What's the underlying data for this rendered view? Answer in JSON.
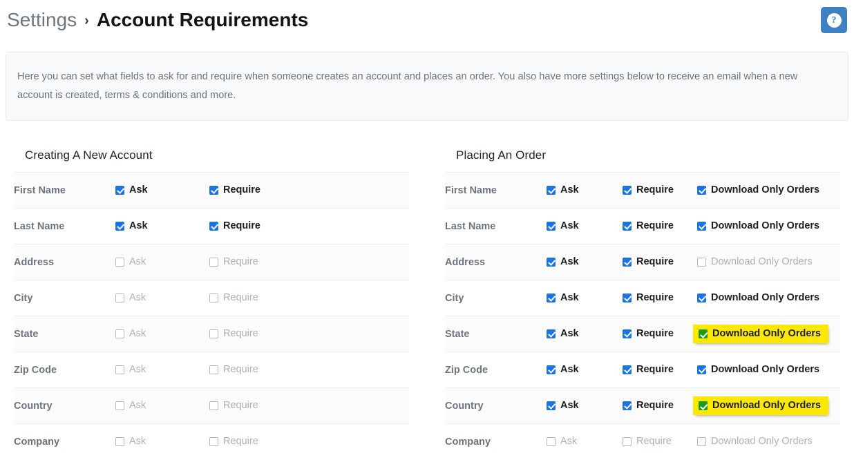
{
  "header": {
    "breadcrumb_parent": "Settings",
    "breadcrumb_separator": "›",
    "breadcrumb_current": "Account Requirements",
    "help_button_glyph": "?",
    "help_button_title": "Help"
  },
  "info_banner": {
    "text": "Here you can set what fields to ask for and require when someone creates an account and places an order. You also have more settings below to receive an email when a new account is created, terms & conditions and more."
  },
  "columns": {
    "left": {
      "title": "Creating A New Account",
      "option_labels": {
        "ask": "Ask",
        "require": "Require"
      },
      "rows": [
        {
          "field": "First Name",
          "ask": true,
          "require": true
        },
        {
          "field": "Last Name",
          "ask": true,
          "require": true
        },
        {
          "field": "Address",
          "ask": false,
          "require": false
        },
        {
          "field": "City",
          "ask": false,
          "require": false
        },
        {
          "field": "State",
          "ask": false,
          "require": false
        },
        {
          "field": "Zip Code",
          "ask": false,
          "require": false
        },
        {
          "field": "Country",
          "ask": false,
          "require": false
        },
        {
          "field": "Company",
          "ask": false,
          "require": false
        }
      ]
    },
    "right": {
      "title": "Placing An Order",
      "option_labels": {
        "ask": "Ask",
        "require": "Require",
        "download": "Download Only Orders"
      },
      "rows": [
        {
          "field": "First Name",
          "ask": true,
          "require": true,
          "download": true,
          "download_highlighted": false
        },
        {
          "field": "Last Name",
          "ask": true,
          "require": true,
          "download": true,
          "download_highlighted": false
        },
        {
          "field": "Address",
          "ask": true,
          "require": true,
          "download": false,
          "download_highlighted": false
        },
        {
          "field": "City",
          "ask": true,
          "require": true,
          "download": true,
          "download_highlighted": false
        },
        {
          "field": "State",
          "ask": true,
          "require": true,
          "download": true,
          "download_highlighted": true
        },
        {
          "field": "Zip Code",
          "ask": true,
          "require": true,
          "download": true,
          "download_highlighted": false
        },
        {
          "field": "Country",
          "ask": true,
          "require": true,
          "download": true,
          "download_highlighted": true
        },
        {
          "field": "Company",
          "ask": false,
          "require": false,
          "download": false,
          "download_highlighted": false
        }
      ]
    }
  },
  "colors": {
    "checkbox_checked": "#1a73e8",
    "checkbox_highlighted": "#199b1f",
    "highlight_marker": "#ffe800",
    "help_button": "#3f80c1",
    "banner_background": "#f8f9fa"
  }
}
